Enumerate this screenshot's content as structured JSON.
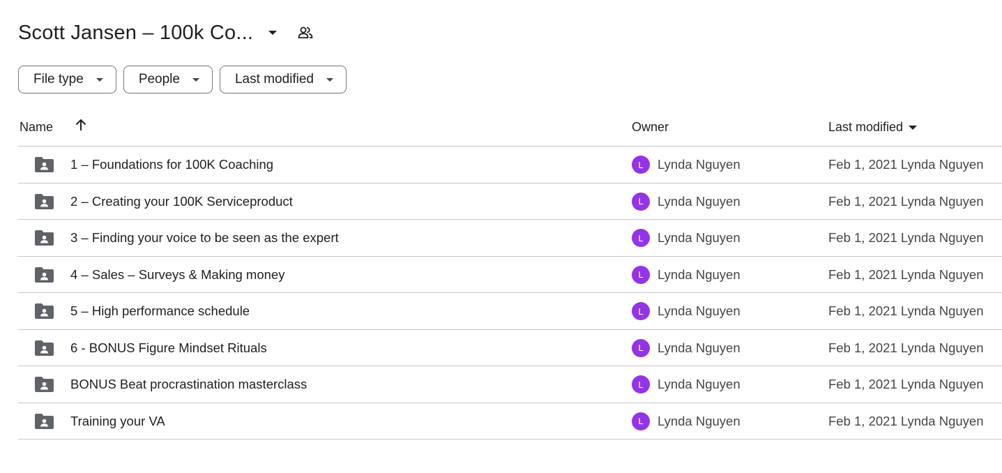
{
  "header": {
    "title": "Scott Jansen – 100k Co...",
    "shared_icon": "people-icon",
    "dropdown_icon": "caret-down-icon"
  },
  "filters": [
    {
      "label": "File type"
    },
    {
      "label": "People"
    },
    {
      "label": "Last modified"
    }
  ],
  "columns": {
    "name": "Name",
    "owner": "Owner",
    "last_modified": "Last modified",
    "sort_icon": "arrow-up-icon"
  },
  "rows": [
    {
      "name": "1 – Foundations for 100K Coaching",
      "owner_initial": "L",
      "owner": "Lynda Nguyen",
      "modified": "Feb 1, 2021 Lynda Nguyen"
    },
    {
      "name": "2 – Creating your 100K Serviceproduct",
      "owner_initial": "L",
      "owner": "Lynda Nguyen",
      "modified": "Feb 1, 2021 Lynda Nguyen"
    },
    {
      "name": "3 – Finding your voice to be seen as the expert",
      "owner_initial": "L",
      "owner": "Lynda Nguyen",
      "modified": "Feb 1, 2021 Lynda Nguyen"
    },
    {
      "name": "4 – Sales – Surveys & Making money",
      "owner_initial": "L",
      "owner": "Lynda Nguyen",
      "modified": "Feb 1, 2021 Lynda Nguyen"
    },
    {
      "name": "5 – High performance schedule",
      "owner_initial": "L",
      "owner": "Lynda Nguyen",
      "modified": "Feb 1, 2021 Lynda Nguyen"
    },
    {
      "name": "6 - BONUS Figure Mindset Rituals",
      "owner_initial": "L",
      "owner": "Lynda Nguyen",
      "modified": "Feb 1, 2021 Lynda Nguyen"
    },
    {
      "name": "BONUS Beat procrastination masterclass",
      "owner_initial": "L",
      "owner": "Lynda Nguyen",
      "modified": "Feb 1, 2021 Lynda Nguyen"
    },
    {
      "name": "Training your VA",
      "owner_initial": "L",
      "owner": "Lynda Nguyen",
      "modified": "Feb 1, 2021 Lynda Nguyen"
    }
  ],
  "colors": {
    "avatar": "#9334e6",
    "folder_icon": "#5f6368",
    "divider": "#c7c7c7"
  },
  "icons": {
    "row_icon": "shared-folder-icon"
  }
}
